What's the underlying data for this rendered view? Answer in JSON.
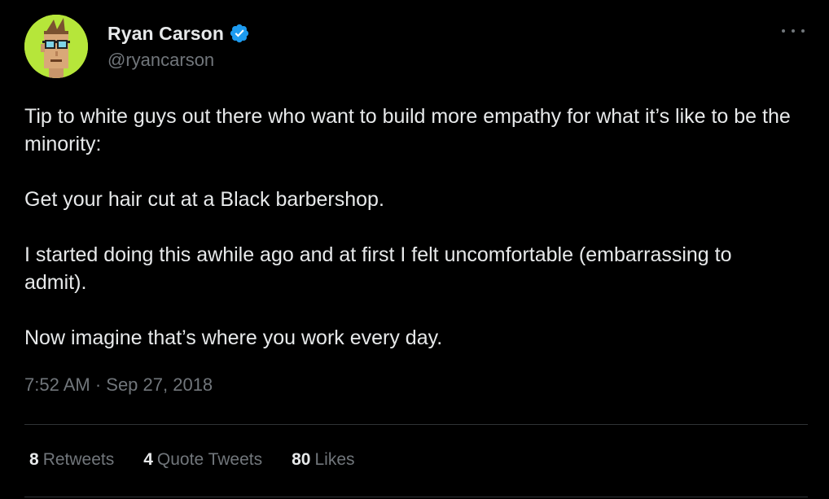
{
  "author": {
    "display_name": "Ryan Carson",
    "handle": "@ryancarson",
    "verified": true,
    "avatar_bg": "#b6e63a",
    "avatar_icon": "pixel-art-avatar-icon"
  },
  "tweet": {
    "paragraphs": [
      "Tip to white guys out there who want to build more empathy for what it’s like to be the minority:",
      "Get your hair cut at a Black barbershop.",
      "I started doing this awhile ago and at first I felt uncomfortable (embarrassing to admit).",
      "Now imagine that’s where you work every day."
    ],
    "timestamp": "7:52 AM · Sep 27, 2018"
  },
  "stats": {
    "retweets": {
      "count": "8",
      "label": "Retweets"
    },
    "quote_tweets": {
      "count": "4",
      "label": "Quote Tweets"
    },
    "likes": {
      "count": "80",
      "label": "Likes"
    }
  },
  "colors": {
    "background": "#000000",
    "text_primary": "#e7e9ea",
    "text_secondary": "#71767b",
    "verified_blue": "#1d9bf0",
    "divider": "#2f3336"
  }
}
